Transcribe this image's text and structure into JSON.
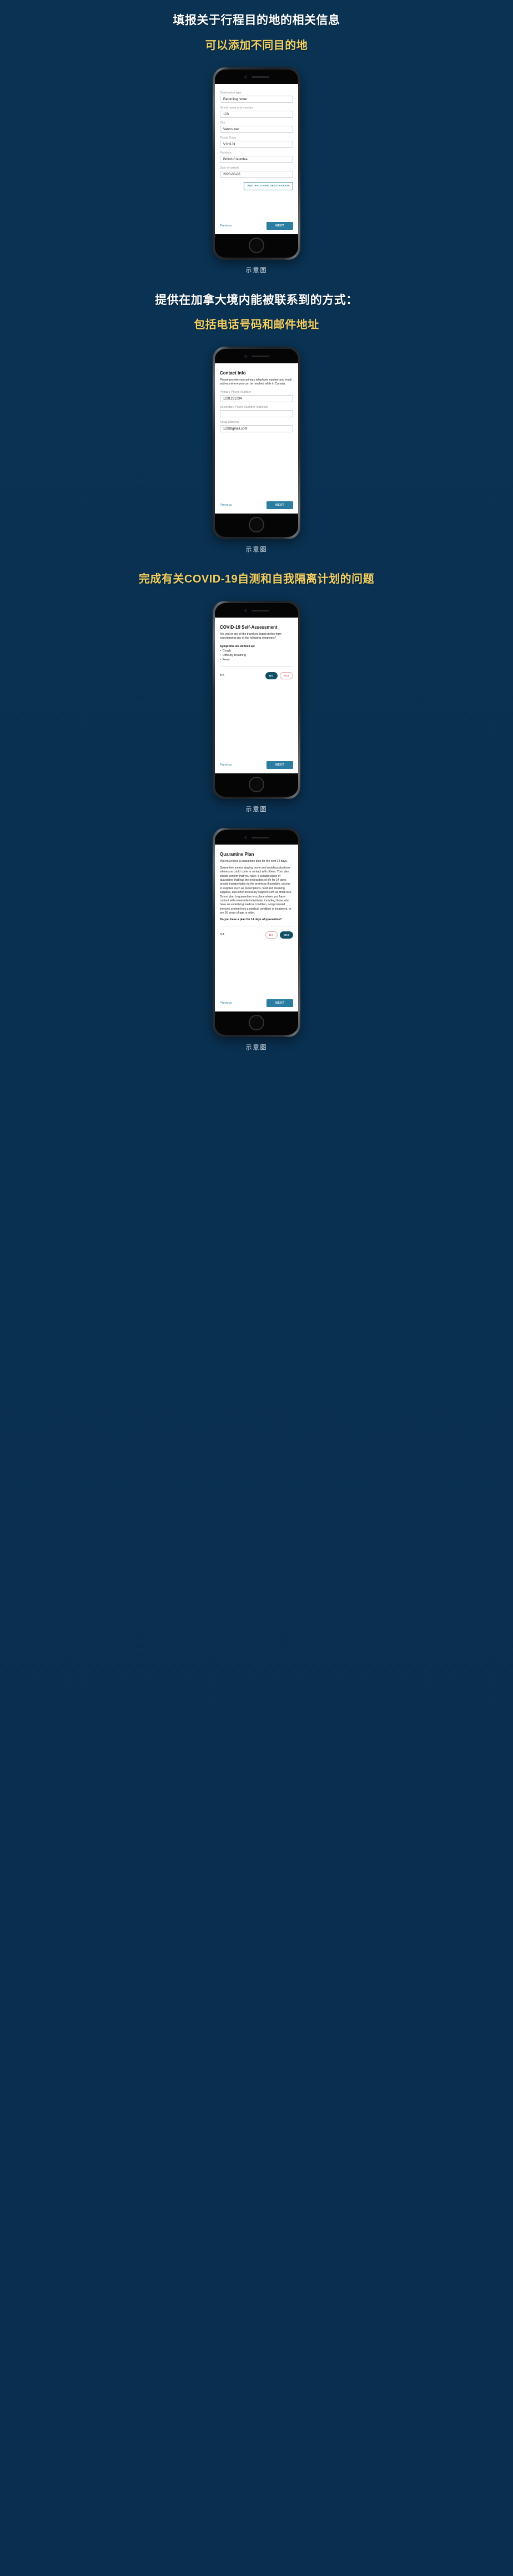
{
  "theme": {
    "background": "#0a3050",
    "heading_white": "#ffffff",
    "heading_gold": "#f2cf63",
    "accent_blue": "#2b7ea1",
    "pill_selected": "#115064",
    "pill_unselected_border": "#e0a3a7"
  },
  "caption": "示意图",
  "sections": [
    {
      "heading_main": "填报关于行程目的地的相关信息",
      "heading_sub": "可以添加不同目的地"
    },
    {
      "heading_main": "提供在加拿大境内能被联系到的方式：",
      "heading_sub": "包括电话号码和邮件地址"
    },
    {
      "heading_main": "完成有关COVID-19自测和自我隔离计划的问题",
      "heading_sub": ""
    }
  ],
  "screen_destination": {
    "fields": [
      {
        "label": "Destination type",
        "value": "Returning home"
      },
      {
        "label": "Street name and number",
        "value": "123"
      },
      {
        "label": "City",
        "value": "Vancouver"
      },
      {
        "label": "Postal Code",
        "value": "V1H1J3"
      },
      {
        "label": "Province",
        "value": "British Columbia"
      },
      {
        "label": "Date of arrival",
        "value": "2020-05-06"
      }
    ],
    "add_destination_label": "ADD ANOTHER DESTINATION",
    "previous_label": "Previous",
    "next_label": "NEXT"
  },
  "screen_contact": {
    "title": "Contact Info",
    "intro": "Please provide your primary telephone number and email address where you can be reached while in Canada.",
    "fields": [
      {
        "label": "Primary Phone Number",
        "value": "1231231234"
      },
      {
        "label": "Secondary Phone Number (optional)",
        "value": ""
      },
      {
        "label": "Email Address",
        "value": "123@gmail.com"
      }
    ],
    "previous_label": "Previous",
    "next_label": "NEXT"
  },
  "screen_covid": {
    "title": "COVID-19 Self-Assessment",
    "question": "Are you or any of the travellers listed on this form experiencing any of the following symptoms?",
    "symptoms_heading": "Symptoms are defined as:",
    "symptoms": [
      "Cough",
      "Difficulty breathing",
      "Fever"
    ],
    "traveller_label": "B A",
    "no_label": "NO",
    "yes_label": "YES",
    "selected": "NO",
    "previous_label": "Previous",
    "next_label": "NEXT"
  },
  "screen_quarantine": {
    "title": "Quarantine Plan",
    "intro": "You must have a quarantine plan for the next 14 days.",
    "body": "Quarantine means staying home and avoiding situations where you could come in contact with others. Your plan should confirm that you have: a suitable place of quarantine that has the necessities of life for 14 days; private transportation to the premises if possible; access to supplies such as prescriptions, food and cleaning supplies, and other necessary support such as child care. Do not plan to quarantine in a place where you have contact with vulnerable individuals, including those who have an underlying medical condition, compromised immune system from a medical condition or treatment, or are 65 years of age or older.",
    "question": "Do you have a plan for 14 days of quarantine?",
    "traveller_label": "B A",
    "no_label": "NO",
    "yes_label": "YES",
    "selected": "YES",
    "previous_label": "Previous",
    "next_label": "NEXT"
  }
}
